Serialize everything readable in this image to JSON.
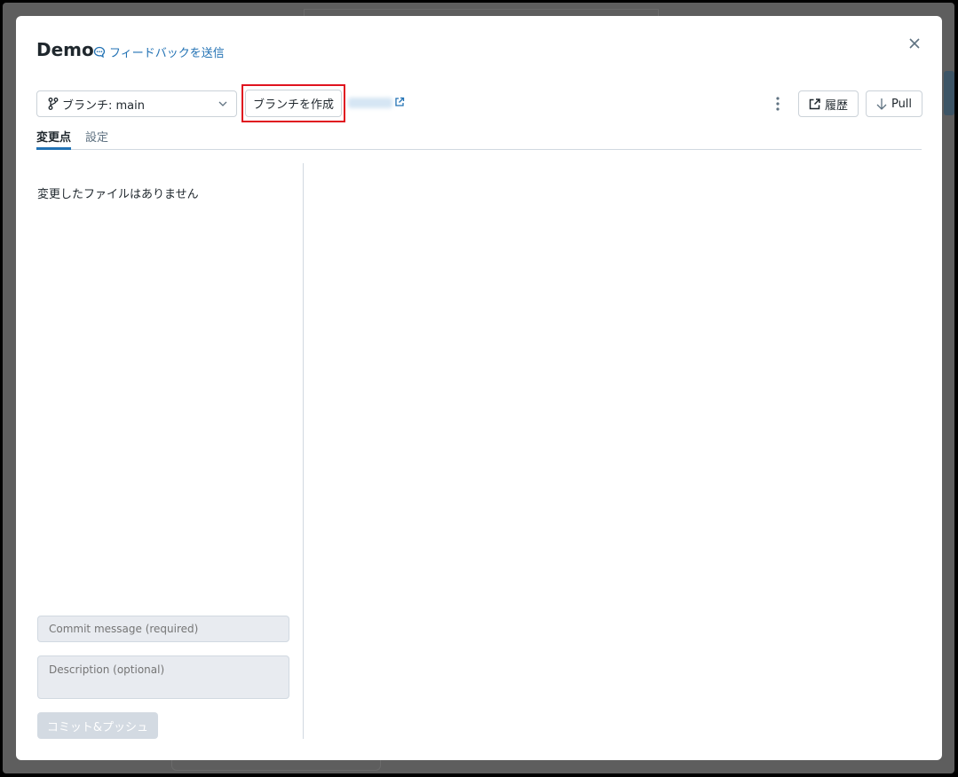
{
  "header": {
    "title": "Demo",
    "feedback_label": "フィードバックを送信"
  },
  "toolbar": {
    "branch_label": "ブランチ: main",
    "create_branch_label": "ブランチを作成",
    "history_label": "履歴",
    "pull_label": "Pull"
  },
  "tabs": [
    {
      "label": "変更点",
      "active": true
    },
    {
      "label": "設定",
      "active": false
    }
  ],
  "changes": {
    "empty_text": "変更したファイルはありません",
    "commit_placeholder": "Commit message (required)",
    "description_placeholder": "Description (optional)",
    "commit_push_label": "コミット&プッシュ"
  },
  "colors": {
    "accent": "#2272b4",
    "highlight": "#e0131f",
    "backdrop": "#5e5e5e"
  }
}
